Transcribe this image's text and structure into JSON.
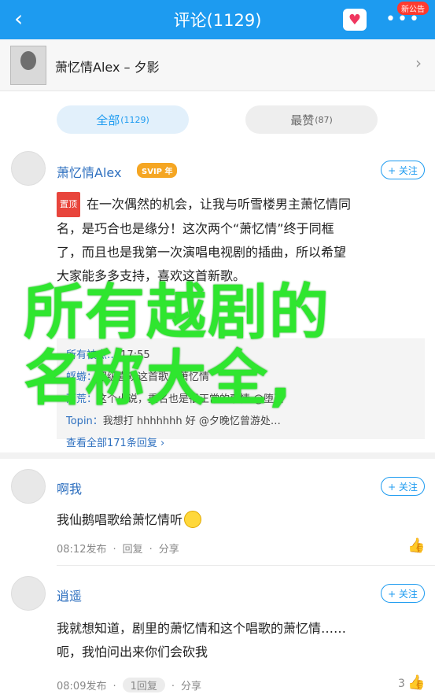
{
  "topbar": {
    "title": "评论(1129)",
    "back_icon": "‹",
    "heart_icon": "♥",
    "more_icon": "•••",
    "badge": "新公告"
  },
  "song": {
    "name": "萧忆情Alex – 夕影",
    "arrow": "›"
  },
  "tabs": {
    "all_label": "全部",
    "all_count": "(1129)",
    "hot_label": "最赞",
    "hot_count": "(87)"
  },
  "comments": [
    {
      "user": "萧忆情Alex",
      "vip": "SVIP 年",
      "follow": "+ 关注",
      "pin": "置顶",
      "lines": [
        "在一次偶然的机会，让我与听雪楼男主萧忆情同",
        "名，是巧合也是缘分！这次两个“萧忆情”终于同框",
        "了，而且也是我第一次演唱电视剧的插曲，所以希望",
        "大家能多多支持，喜欢这首新歌。"
      ],
      "replies": [
        {
          "who": "所有被点…",
          "text": "17:55"
        },
        {
          "who": "蜉蝣：",
          "text": "超级喜欢这首歌，萧忆情"
        },
        {
          "who": "雨荒：",
          "text": "这个小说，重名也是很正常的事情 @堕落"
        },
        {
          "who": "Topin：",
          "text": "我想打 hhhhhhh 好 @夕晚忆曾游处…"
        }
      ],
      "view_all": "查看全部171条回复 ›"
    },
    {
      "user": "啊我",
      "follow": "+ 关注",
      "text": "我仙鹅唱歌给萧忆情听",
      "time": "08:12发布",
      "reply": "回复",
      "share": "分享"
    },
    {
      "user": "逍遥",
      "follow": "+ 关注",
      "lines": [
        "我就想知道，剧里的萧忆情和这个唱歌的萧忆情……",
        "呃，我怕问出来你们会砍我"
      ],
      "time": "08:09发布",
      "reply": "1回复",
      "share": "分享",
      "likes": "3"
    }
  ],
  "overlay": {
    "line1": "所有越剧的",
    "line2": "名称大全,"
  },
  "icons": {
    "like": "thumbs-up-icon"
  },
  "colors": {
    "accent": "#1d9bf0",
    "overlay": "#2fe62f"
  }
}
